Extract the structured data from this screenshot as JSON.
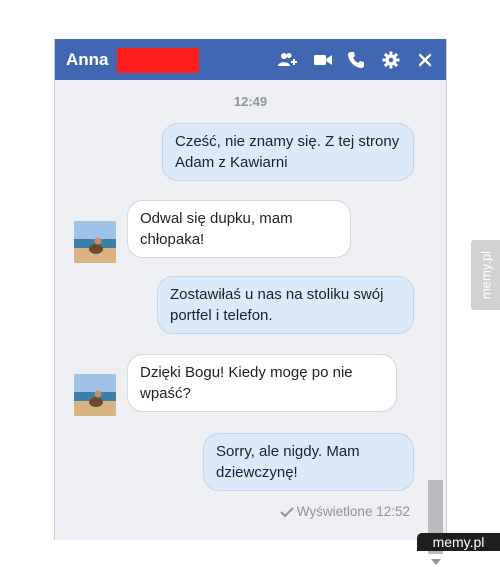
{
  "header": {
    "contact_name": "Anna",
    "icons": [
      "add-person-icon",
      "video-call-icon",
      "phone-icon",
      "gear-icon",
      "close-icon"
    ]
  },
  "thread": {
    "timestamp": "12:49",
    "messages": [
      {
        "direction": "outgoing",
        "text": "Cześć, nie znamy się. Z tej strony Adam z Kawiarni"
      },
      {
        "direction": "incoming",
        "text": "Odwal się dupku, mam chłopaka!"
      },
      {
        "direction": "outgoing",
        "text": "Zostawiłaś u nas na stoliku swój portfel i telefon."
      },
      {
        "direction": "incoming",
        "text": "Dzięki Bogu! Kiedy mogę po nie wpaść?"
      },
      {
        "direction": "outgoing",
        "text": "Sorry, ale nigdy. Mam dziewczynę!"
      }
    ],
    "seen_status": "Wyświetlone 12:52"
  },
  "watermark": {
    "side_text": "memy.pl",
    "logo_text": "memy.pl"
  },
  "colors": {
    "header": "#4267b2",
    "outgoing_bubble": "#dbe9f8",
    "incoming_bubble": "#ffffff",
    "redaction": "#ff1f1f",
    "background": "#edeff2"
  }
}
